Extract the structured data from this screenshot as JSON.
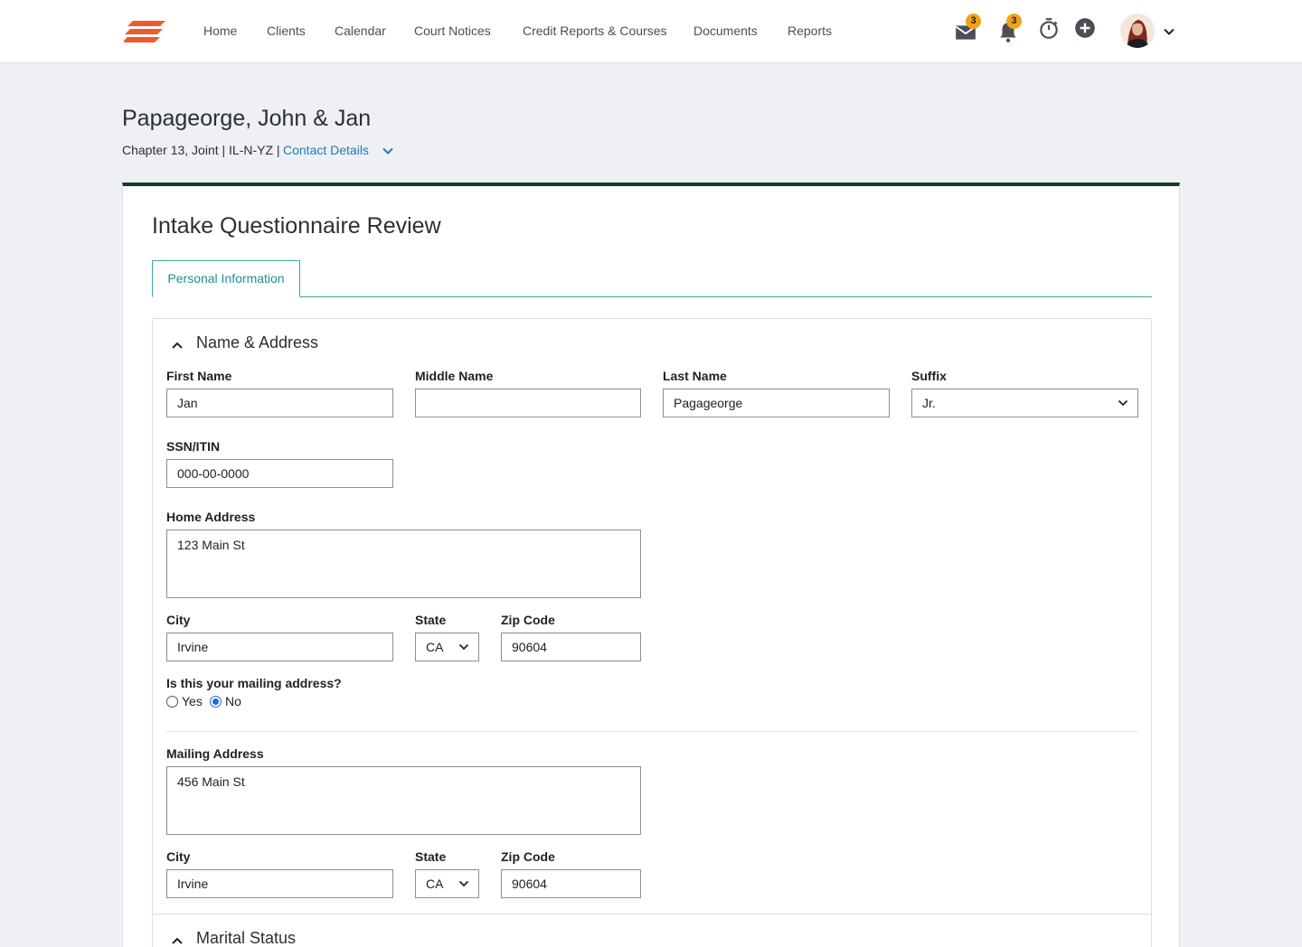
{
  "nav": {
    "items": [
      "Home",
      "Clients",
      "Calendar",
      "Court Notices",
      "Credit Reports & Courses",
      "Documents",
      "Reports"
    ],
    "mail_badge": "3",
    "bell_badge": "3"
  },
  "colors": {
    "brand_orange": "#f05a28",
    "accent_teal": "#21908f",
    "card_top": "#17392e",
    "badge": "#f0a21b",
    "link": "#1e7bb8"
  },
  "client": {
    "name": "Papageorge, John & Jan",
    "meta": "Chapter 13, Joint | IL-N-YZ |",
    "contact_link": "Contact Details"
  },
  "card": {
    "title": "Intake Questionnaire Review",
    "tab": "Personal Information"
  },
  "section_name": {
    "title": "Name & Address",
    "first_name_label": "First Name",
    "first_name": "Jan",
    "middle_name_label": "Middle Name",
    "middle_name": "",
    "last_name_label": "Last Name",
    "last_name": "Pagageorge",
    "suffix_label": "Suffix",
    "suffix": "Jr.",
    "ssn_label": "SSN/ITIN",
    "ssn": "000-00-0000",
    "home_address_label": "Home Address",
    "home_address": "123 Main St",
    "city_label": "City",
    "city": "Irvine",
    "state_label": "State",
    "state": "CA",
    "zip_label": "Zip Code",
    "zip": "90604",
    "mailing_question": "Is this your mailing address?",
    "yes_label": "Yes",
    "no_label": "No",
    "mailing_selected": "No",
    "mailing_address_label": "Mailing Address",
    "mailing_address": "456 Main St",
    "mailing_city_label": "City",
    "mailing_city": "Irvine",
    "mailing_state_label": "State",
    "mailing_state": "CA",
    "mailing_zip_label": "Zip Code",
    "mailing_zip": "90604"
  },
  "section_marital": {
    "title": "Marital Status"
  }
}
